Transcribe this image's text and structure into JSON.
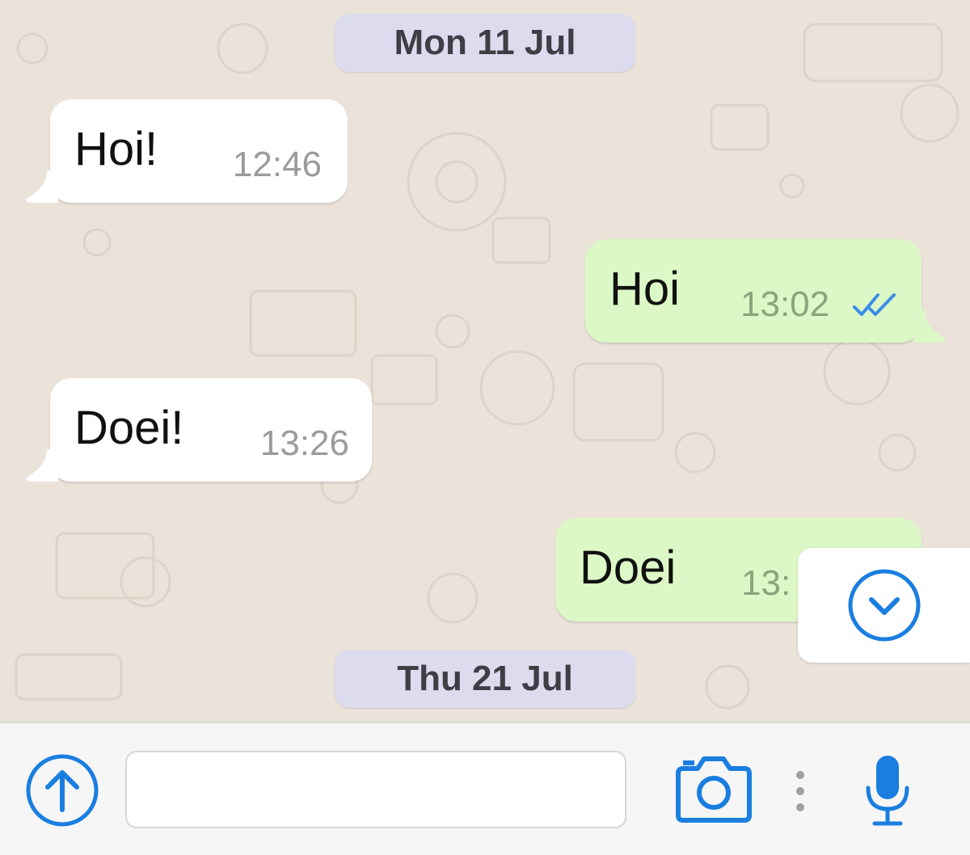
{
  "dates": [
    "Mon 11 Jul",
    "Thu 21 Jul"
  ],
  "messages": [
    {
      "direction": "incoming",
      "text": "Hoi!",
      "time": "12:46"
    },
    {
      "direction": "outgoing",
      "text": "Hoi",
      "time": "13:02",
      "status": "read-ticks-icon"
    },
    {
      "direction": "incoming",
      "text": "Doei!",
      "time": "13:26"
    },
    {
      "direction": "outgoing",
      "text": "Doei",
      "time": "13:"
    }
  ],
  "composer": {
    "placeholder": "",
    "value": ""
  },
  "icons": {
    "attach": "upload-arrow-icon",
    "camera": "camera-icon",
    "more": "vertical-dots-icon",
    "mic": "microphone-icon",
    "scroll": "chevron-down-icon"
  },
  "colors": {
    "accent": "#1a7ee0",
    "incoming_bubble": "#ffffff",
    "outgoing_bubble": "#dcf8c6",
    "date_chip": "#dcdcee",
    "read_ticks": "#3b8ee8"
  }
}
